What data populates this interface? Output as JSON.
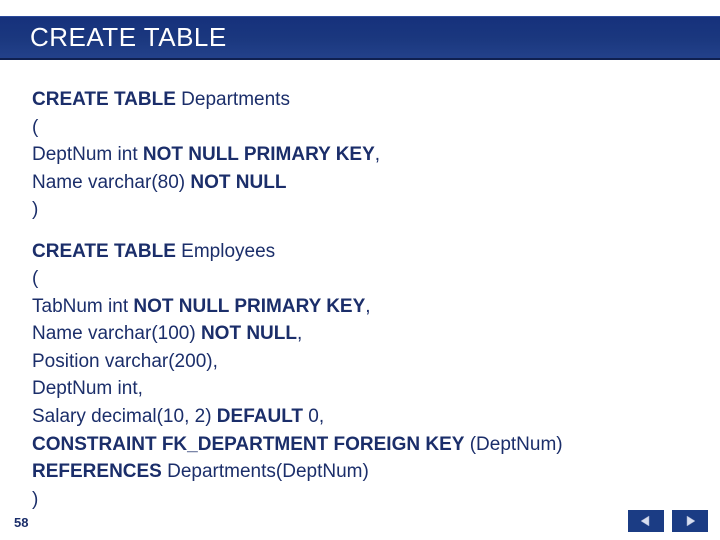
{
  "title": "CREATE TABLE",
  "pageNumber": "58",
  "block1": {
    "kw1": "CREATE TABLE",
    "name": " Departments",
    "open": "(",
    "l1a": "DeptNum int ",
    "l1b": "NOT NULL PRIMARY KEY",
    "l1c": ",",
    "l2a": "Name varchar(80) ",
    "l2b": "NOT NULL",
    "close": ")"
  },
  "block2": {
    "kw1": "CREATE TABLE",
    "name": " Employees",
    "open": "(",
    "l1a": "TabNum int ",
    "l1b": "NOT NULL PRIMARY KEY",
    "l1c": ",",
    "l2a": "Name varchar(100) ",
    "l2b": "NOT NULL",
    "l2c": ",",
    "l3": "Position varchar(200),",
    "l4": "DeptNum int,",
    "l5a": "Salary decimal(10, 2) ",
    "l5b": "DEFAULT",
    "l5c": " 0,",
    "l6a": "CONSTRAINT FK_DEPARTMENT FOREIGN KEY",
    "l6b": " (DeptNum)",
    "l7a": "REFERENCES",
    "l7b": " Departments(DeptNum)",
    "close": ")"
  }
}
